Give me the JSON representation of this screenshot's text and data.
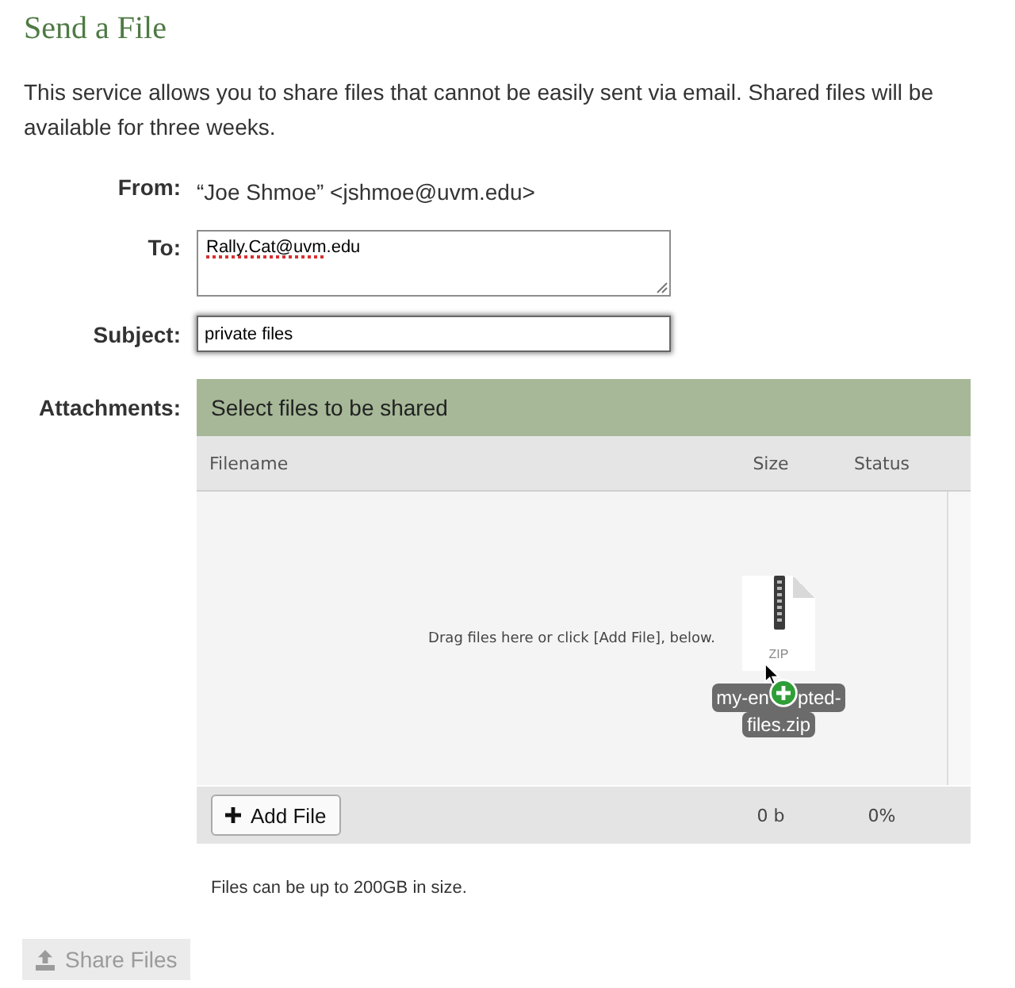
{
  "page_title": "Send a File",
  "intro": "This service allows you to share files that cannot be easily sent via email. Shared files will be available for three weeks.",
  "form": {
    "from": {
      "label": "From:",
      "value": "“Joe Shmoe” <jshmoe@uvm.edu>"
    },
    "to": {
      "label": "To:",
      "value_parts": [
        {
          "text": "Rally.Cat@uvm",
          "misspelled": true
        },
        {
          "text": ".edu",
          "misspelled": false
        }
      ]
    },
    "subject": {
      "label": "Subject:",
      "value": "private files",
      "focused": true
    },
    "attachments": {
      "label": "Attachments:"
    }
  },
  "uploader": {
    "title": "Select files to be shared",
    "columns": [
      "Filename",
      "Size",
      "Status"
    ],
    "drop_hint": "Drag files here or click [Add File], below.",
    "dragged_file": {
      "type_label": "ZIP",
      "name_parts": [
        "my-en",
        "pted-",
        "files.zip"
      ]
    },
    "add_button": "Add File",
    "total_size": "0 b",
    "total_status": "0%",
    "limit_note": "Files can be up to 200GB in size."
  },
  "share_button": {
    "label": "Share Files",
    "disabled": true
  }
}
